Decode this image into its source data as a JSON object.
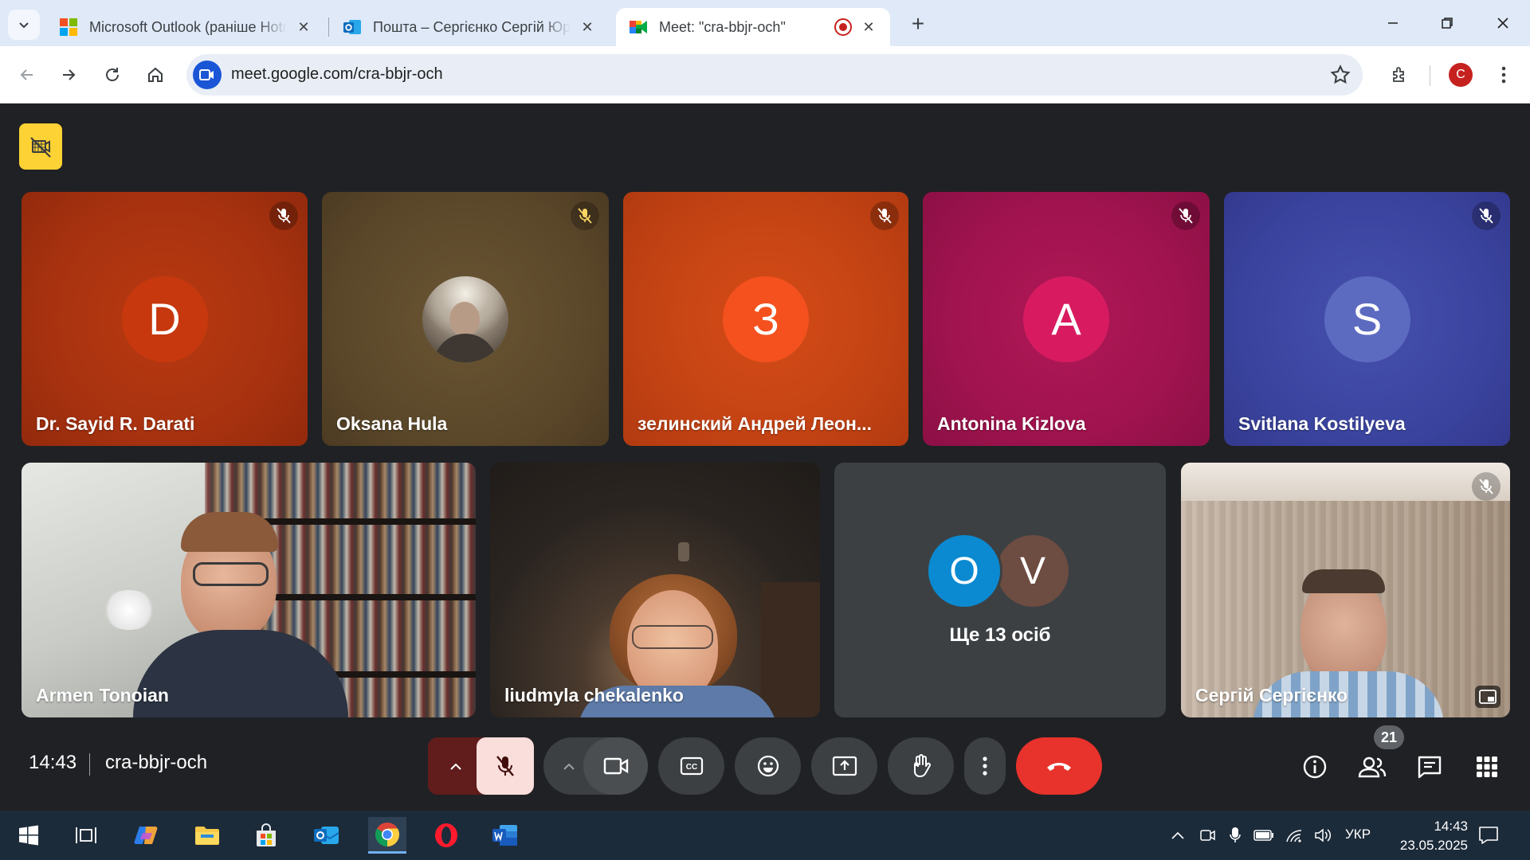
{
  "browser": {
    "tabs": [
      {
        "title": "Microsoft Outlook (раніше Hotmail)",
        "icon": "microsoft-logo-icon",
        "active": false
      },
      {
        "title": "Пошта – Сергієнко Сергій Юрійович",
        "icon": "outlook-icon",
        "active": false
      },
      {
        "title": "Meet: \"cra-bbjr-och\"",
        "icon": "google-meet-icon",
        "active": true
      }
    ],
    "url": "meet.google.com/cra-bbjr-och",
    "profile_initial": "С"
  },
  "meet": {
    "participants_top": [
      {
        "name": "Dr. Sayid R. Darati",
        "initial": "D",
        "muted": true
      },
      {
        "name": "Oksana Hula",
        "initial": "",
        "muted": true,
        "photo": true
      },
      {
        "name": "зелинский Андрей Леон...",
        "initial": "З",
        "muted": true
      },
      {
        "name": "Antonina Kizlova",
        "initial": "A",
        "muted": true
      },
      {
        "name": "Svitlana Kostilyeva",
        "initial": "S",
        "muted": true
      }
    ],
    "participants_bottom": [
      {
        "name": "Armen Tonoian",
        "video": true
      },
      {
        "name": "liudmyla chekalenko",
        "video": true
      },
      {
        "name": "Сергій Сергієнко",
        "video": true,
        "muted": true
      }
    ],
    "others": {
      "avatars": [
        {
          "initial": "O",
          "color": "#0b8ad1"
        },
        {
          "initial": "V",
          "color": "#6d4c41"
        }
      ],
      "label": "Ще 13 осіб"
    },
    "time": "14:43",
    "meeting_code": "cra-bbjr-och",
    "people_count": "21",
    "colors": {
      "end_call": "#e8322c",
      "mic_off_bg": "#f9dedc",
      "badge_yellow": "#fdd234"
    }
  },
  "taskbar": {
    "language": "УКР",
    "time": "14:43",
    "date": "23.05.2025"
  }
}
